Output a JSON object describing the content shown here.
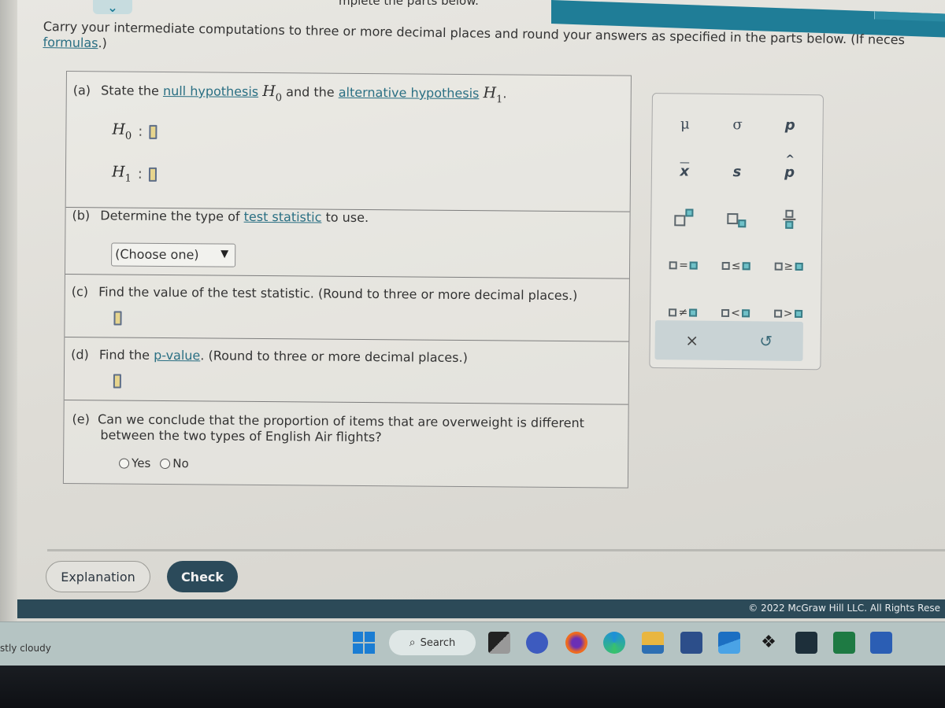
{
  "header": {
    "intro_partial": "mplete the parts below.",
    "instructions": "Carry your intermediate computations to three or more decimal places and round your answers as specified in the parts below. (If neces",
    "instructions_link": "formulas",
    "instructions_tail": ".)"
  },
  "parts": {
    "a": {
      "label": "(a)",
      "text_1": "State the",
      "link_1": "null hypothesis",
      "sym_1": "H",
      "sub_1": "0",
      "text_2": "and the",
      "link_2": "alternative hypothesis",
      "sym_2": "H",
      "sub_2": "1",
      "text_3": ".",
      "h0_symbol": "H",
      "h0_sub": "0",
      "h1_symbol": "H",
      "h1_sub": "1",
      "colon": ":",
      "h0_value": "",
      "h1_value": ""
    },
    "b": {
      "label": "(b)",
      "text_1": "Determine the type of",
      "link": "test statistic",
      "text_2": "to use.",
      "select_value": "(Choose one)",
      "select_arrow": "▼"
    },
    "c": {
      "label": "(c)",
      "text": "Find the value of the test statistic. (Round to three or more decimal places.)",
      "value": ""
    },
    "d": {
      "label": "(d)",
      "text_1": "Find the",
      "link": "p-value",
      "text_2": ". (Round to three or more decimal places.)",
      "value": ""
    },
    "e": {
      "label": "(e)",
      "text": "Can we conclude that the proportion of items that are overweight is different between the two types of English Air flights?",
      "options": [
        "Yes",
        "No"
      ]
    }
  },
  "palette": {
    "row1": [
      "μ",
      "σ",
      "p"
    ],
    "row2": [
      "x",
      "s",
      "p"
    ],
    "relations": [
      "=",
      "≤",
      "≥",
      "≠",
      "<",
      ">"
    ],
    "clear": "×",
    "undo": "↺"
  },
  "buttons": {
    "explanation": "Explanation",
    "check": "Check"
  },
  "footer": {
    "copyright": "© 2022 McGraw Hill LLC. All Rights Rese"
  },
  "taskbar": {
    "weather": "stly cloudy",
    "search": "Search",
    "apps": [
      "start",
      "search",
      "task-view",
      "teams-meet",
      "firefox",
      "edge",
      "file-explorer",
      "microsoft-store",
      "mail",
      "dropbox",
      "app-tile",
      "excel",
      "word"
    ]
  },
  "colors": {
    "accent": "#1f7d97",
    "check_button": "#2b4a5a",
    "answer_box": "#e7d58e",
    "link": "#2a6f83"
  }
}
